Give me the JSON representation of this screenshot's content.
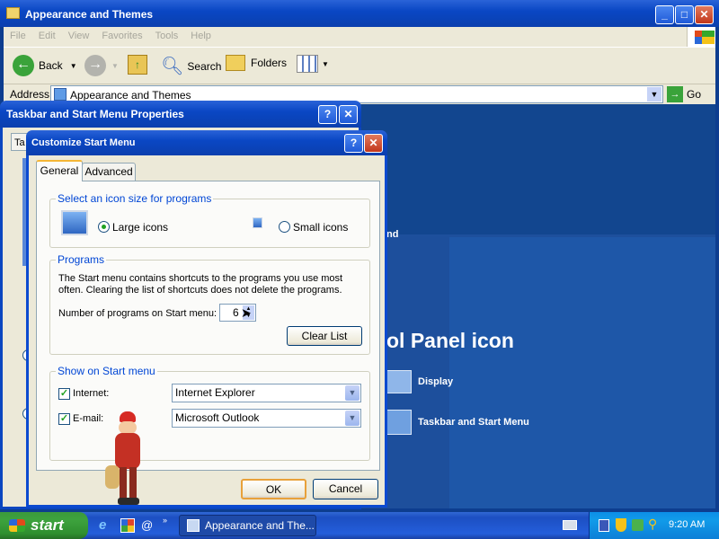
{
  "explorer": {
    "title": "Appearance and Themes",
    "menu": [
      "File",
      "Edit",
      "View",
      "Favorites",
      "Tools",
      "Help"
    ],
    "toolbar": {
      "back": "Back",
      "search": "Search",
      "folders": "Folders"
    },
    "address": {
      "label": "Address",
      "value": "Appearance and Themes",
      "go": "Go"
    },
    "content": {
      "partial_heading": "ol Panel icon",
      "partial_text": "nd",
      "items": [
        "Display",
        "Taskbar and Start Menu"
      ]
    }
  },
  "tbprops": {
    "title": "Taskbar and Start Menu Properties",
    "tab_partial": "Ta"
  },
  "customize": {
    "title": "Customize Start Menu",
    "tabs": [
      "General",
      "Advanced"
    ],
    "icon_size": {
      "legend": "Select an icon size for programs",
      "large": "Large icons",
      "small": "Small icons",
      "selected": "large"
    },
    "programs": {
      "legend": "Programs",
      "description": "The Start menu contains shortcuts to the programs you use most often. Clearing the list of shortcuts does not delete the programs.",
      "count_label": "Number of programs on Start menu:",
      "count_value": "6",
      "clear_button": "Clear List"
    },
    "show_on": {
      "legend": "Show on Start menu",
      "internet_label": "Internet:",
      "internet_checked": true,
      "internet_value": "Internet Explorer",
      "email_label": "E-mail:",
      "email_checked": true,
      "email_value": "Microsoft Outlook"
    },
    "ok": "OK",
    "cancel": "Cancel"
  },
  "taskbar": {
    "start": "start",
    "task": "Appearance and The...",
    "time": "9:20 AM"
  }
}
